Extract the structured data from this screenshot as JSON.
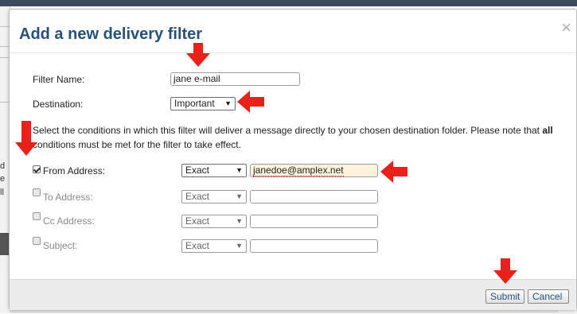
{
  "dialog": {
    "title": "Add a new delivery filter",
    "close_glyph": "×"
  },
  "form": {
    "filter_name_label": "Filter Name:",
    "filter_name_value": "jane e-mail",
    "destination_label": "Destination:",
    "destination_value": "Important",
    "description_pre": "Select the conditions in which this filter will deliver a message directly to your chosen destination folder. Please note that ",
    "description_bold": "all",
    "description_post": " conditions must be met for the filter to take effect."
  },
  "conditions": [
    {
      "label": "From Address:",
      "checked": true,
      "match": "Exact",
      "value": "janedoe@amplex.net"
    },
    {
      "label": "To Address:",
      "checked": false,
      "match": "Exact",
      "value": ""
    },
    {
      "label": "Cc Address:",
      "checked": false,
      "match": "Exact",
      "value": ""
    },
    {
      "label": "Subject:",
      "checked": false,
      "match": "Exact",
      "value": ""
    }
  ],
  "buttons": {
    "submit": "Submit",
    "cancel": "Cancel"
  },
  "background": {
    "fragments": [
      "d",
      "e",
      "ll"
    ]
  },
  "icons": {
    "dropdown": "caret-down-icon",
    "annotation": "red-arrow-icon",
    "close": "close-icon"
  },
  "colors": {
    "title": "#27507a",
    "annotation_arrow": "#e8221b",
    "highlight_input": "#fdf3dc"
  }
}
